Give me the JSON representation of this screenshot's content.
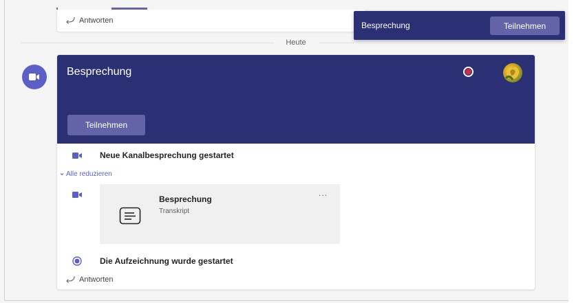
{
  "previous_message": {
    "reply_label": "Antworten"
  },
  "divider": {
    "label": "Heute"
  },
  "toast": {
    "title": "Besprechung",
    "join_label": "Teilnehmen"
  },
  "meeting_card": {
    "title": "Besprechung",
    "join_label": "Teilnehmen",
    "events": [
      {
        "label": "Neue Kanalbesprechung gestartet",
        "icon": "video-camera-icon"
      },
      {
        "label": "Die Aufzeichnung wurde gestartet",
        "icon": "recording-icon"
      }
    ],
    "collapse_label": "Alle reduzieren",
    "recording_tile": {
      "title": "Besprechung",
      "subtitle": "Transkript",
      "more_label": "..."
    },
    "reply_label": "Antworten"
  },
  "colors": {
    "brand": "#6264a7",
    "banner": "#2b2f73",
    "record": "#c4314b",
    "link": "#5b5fc7"
  }
}
